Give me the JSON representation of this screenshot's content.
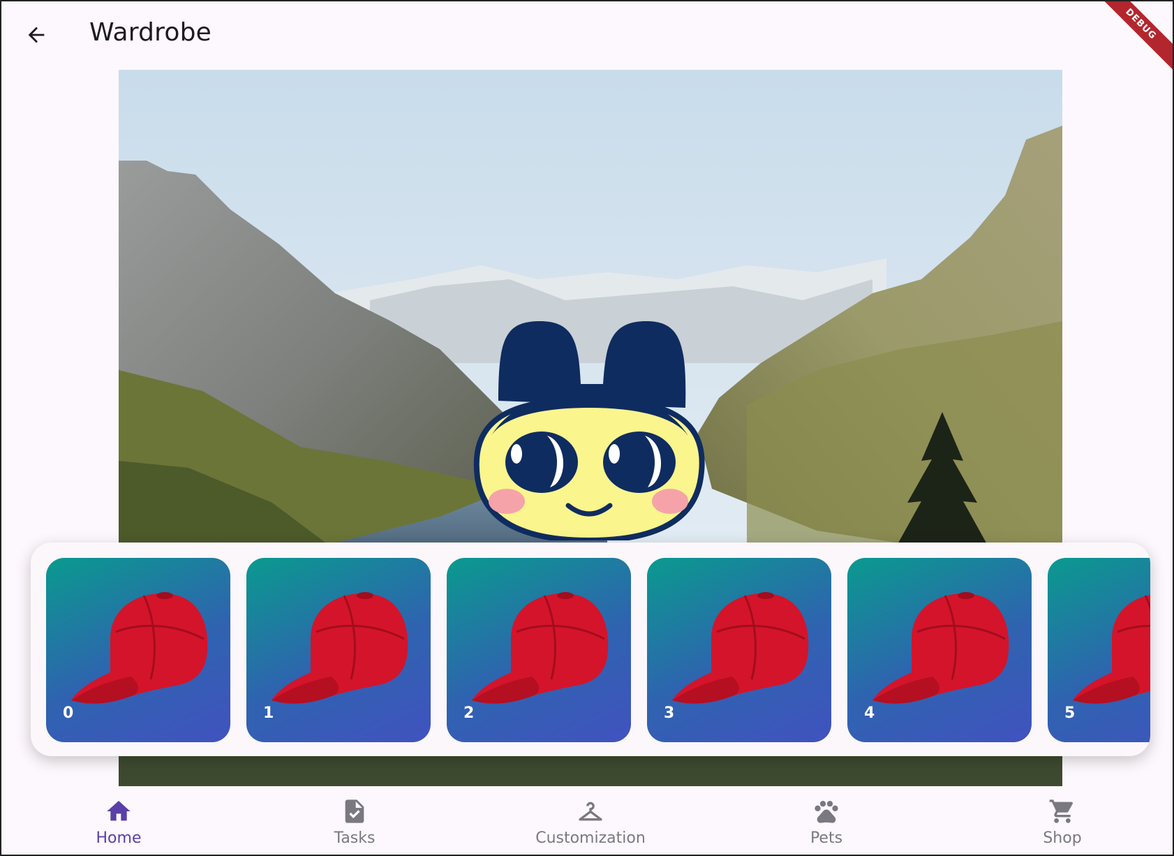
{
  "appbar": {
    "title": "Wardrobe",
    "back_icon": "arrow-left-icon"
  },
  "debug_banner": "DEBUG",
  "items": [
    {
      "label": "0",
      "icon": "red-cap"
    },
    {
      "label": "1",
      "icon": "red-cap"
    },
    {
      "label": "2",
      "icon": "red-cap"
    },
    {
      "label": "3",
      "icon": "red-cap"
    },
    {
      "label": "4",
      "icon": "red-cap"
    },
    {
      "label": "5",
      "icon": "red-cap"
    }
  ],
  "bottom_nav": [
    {
      "label": "Home",
      "icon": "home-icon",
      "active": true
    },
    {
      "label": "Tasks",
      "icon": "task-file-icon",
      "active": false
    },
    {
      "label": "Customization",
      "icon": "hanger-icon",
      "active": false
    },
    {
      "label": "Pets",
      "icon": "paw-icon",
      "active": false
    },
    {
      "label": "Shop",
      "icon": "cart-icon",
      "active": false
    }
  ],
  "colors": {
    "active": "#5a3fa8",
    "inactive": "#7a7980",
    "card_start": "#0a9a8e",
    "card_end": "#4152bf",
    "cap": "#d4142a"
  }
}
